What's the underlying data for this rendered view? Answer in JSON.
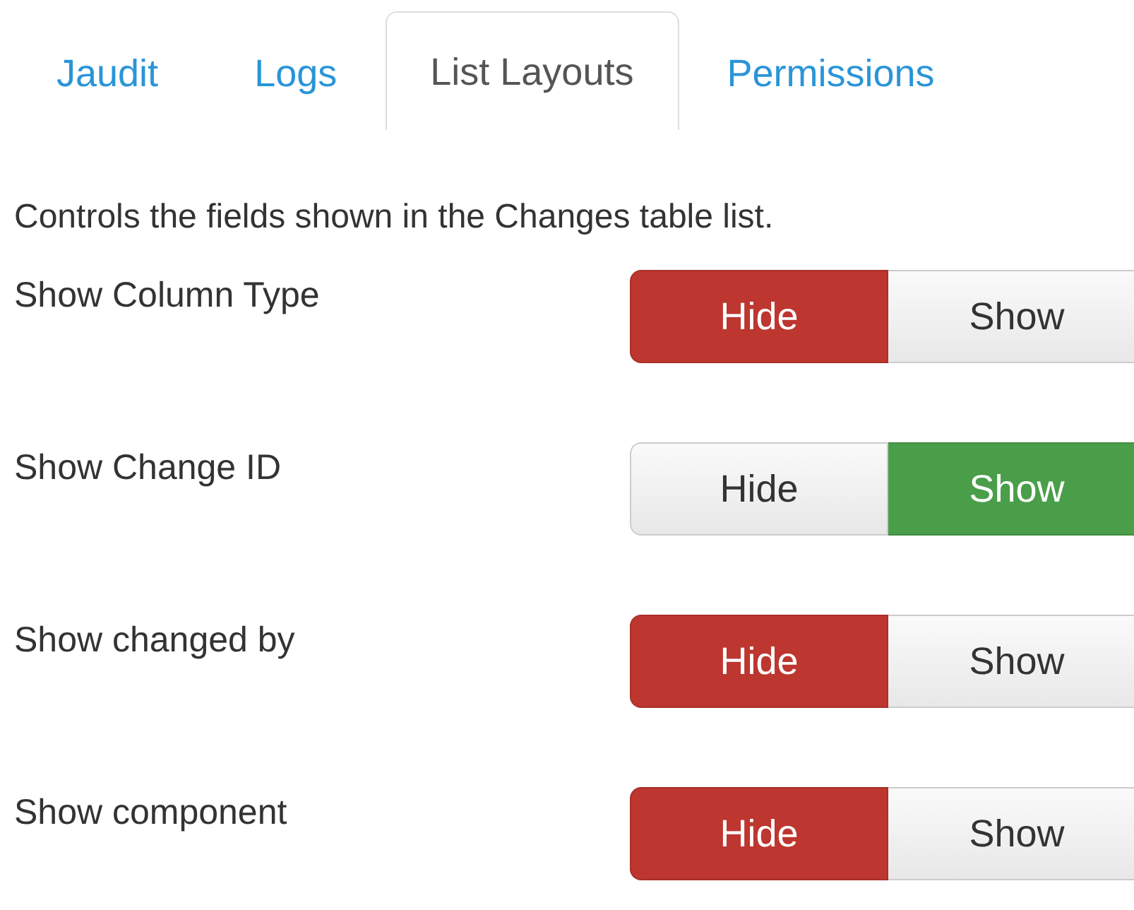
{
  "tabs": [
    {
      "label": "Jaudit",
      "selected": false
    },
    {
      "label": "Logs",
      "selected": false
    },
    {
      "label": "List Layouts",
      "selected": true
    },
    {
      "label": "Permissions",
      "selected": false
    }
  ],
  "description": "Controls the fields shown in the Changes table list.",
  "settings": [
    {
      "label": "Show Column Type",
      "color": "#bd362f",
      "options": [
        {
          "label": "Hide",
          "selected": true
        },
        {
          "label": "Show",
          "selected": false
        }
      ]
    },
    {
      "label": "Show Change ID",
      "color": "#4a9e4a",
      "options": [
        {
          "label": "Hide",
          "selected": false
        },
        {
          "label": "Show",
          "selected": true
        }
      ]
    },
    {
      "label": "Show changed by",
      "color": "#bd362f",
      "options": [
        {
          "label": "Hide",
          "selected": true
        },
        {
          "label": "Show",
          "selected": false
        }
      ]
    },
    {
      "label": "Show component",
      "color": "#bd362f",
      "options": [
        {
          "label": "Hide",
          "selected": true
        },
        {
          "label": "Show",
          "selected": false
        }
      ]
    }
  ]
}
